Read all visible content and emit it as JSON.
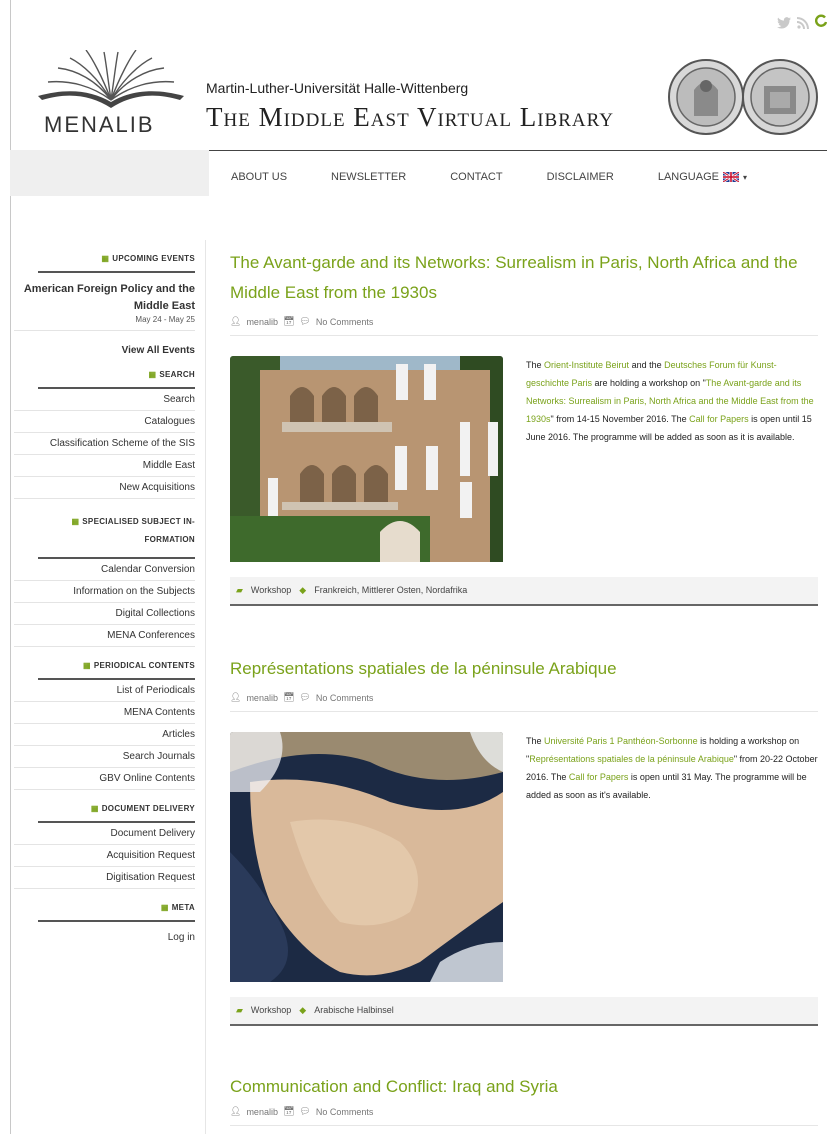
{
  "header": {
    "logo_text": "MENALIB",
    "university": "Martin-Luther-Universität Halle-Wittenberg",
    "site_title": "The Middle East Virtual Library"
  },
  "nav": {
    "items": [
      "ABOUT US",
      "NEWSLETTER",
      "CONTACT",
      "DISCLAIMER",
      "LANGUAGE"
    ]
  },
  "sidebar": {
    "events": {
      "heading": "UPCOMING EVENTS",
      "event_title": "American Foreign Policy and the Middle East",
      "event_date": "May 24 - May 25",
      "view_all": "View All Events"
    },
    "search": {
      "heading": "SEARCH",
      "items": [
        "Search",
        "Catalogues",
        "Classification Scheme of the SIS",
        "Middle East",
        "New Acquisitions"
      ]
    },
    "specialised": {
      "heading": "SPECIALISED SUBJECT IN-FORMATION",
      "items": [
        "Calendar Conversion",
        "Information on the Subjects",
        "Digital Collections",
        "MENA Conferences"
      ]
    },
    "periodical": {
      "heading": "PERIODICAL CONTENTS",
      "items": [
        "List of Periodicals",
        "MENA Contents",
        "Articles",
        "Search Journals",
        "GBV Online Contents"
      ]
    },
    "delivery": {
      "heading": "DOCUMENT DELIVERY",
      "items": [
        "Document Delivery",
        "Acquisition Request",
        "Digitisation Request"
      ]
    },
    "meta": {
      "heading": "META",
      "items": [
        "Log in"
      ]
    }
  },
  "posts": [
    {
      "title": "The Avant-garde and its Networks: Surrealism in Paris, North Africa and the Middle East from the 1930s",
      "author": "menalib",
      "comments": "No Comments",
      "body": {
        "t1": "The ",
        "l1": "Orient-Institute Beirut",
        "t2": " and the ",
        "l2": "Deutsches Forum für Kunst-geschichte Paris",
        "t3": " are holding a workshop on \"",
        "l3": "The Avant-garde and its Networks: Surrealism in Paris, North Africa and the Middle East from the 1930s",
        "t4": "\" from 14-15 November 2016. The ",
        "l4": "Call for Papers",
        "t5": " is open until 15 June 2016. The programme will be added as soon as it is available."
      },
      "category": "Workshop",
      "tags": "Frankreich, Mittlerer Osten, Nordafrika"
    },
    {
      "title": "Représentations spatiales de la péninsule Arabique",
      "author": "menalib",
      "comments": "No Comments",
      "body": {
        "t1": "The ",
        "l1": "Université Paris 1 Panthéon-Sorbonne",
        "t2": " is holding a workshop on \"",
        "l2": "Représentations spatiales de la péninsule Arabique",
        "t3": "\" from 20-22 October 2016. The ",
        "l3": "Call for Papers",
        "t4": " is open until 31 May. The programme will be added as soon as it's available."
      },
      "category": "Workshop",
      "tags": "Arabische Halbinsel"
    },
    {
      "title": "Communication and Conflict: Iraq and Syria",
      "author": "menalib",
      "comments": "No Comments"
    }
  ],
  "colors": {
    "accent": "#7aa21a"
  }
}
